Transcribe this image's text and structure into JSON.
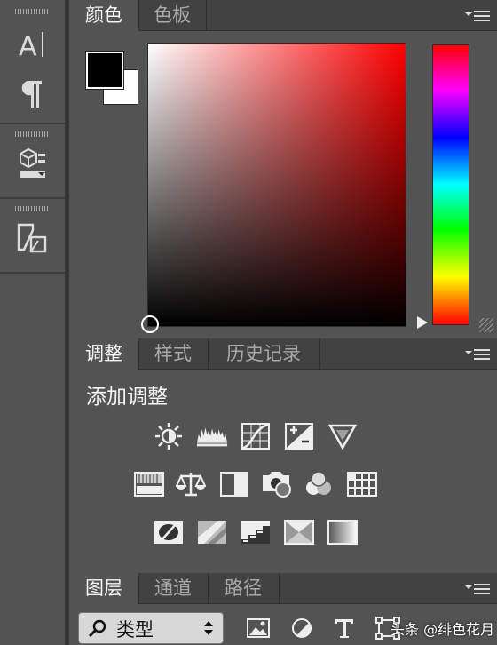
{
  "left_strip": {
    "tools": [
      {
        "icon": "character-icon"
      },
      {
        "icon": "paragraph-icon"
      },
      {
        "icon": "3d-icon"
      },
      {
        "icon": "clone-source-icon"
      }
    ]
  },
  "color_panel": {
    "tabs": [
      {
        "label": "颜色"
      },
      {
        "label": "色板"
      }
    ],
    "foreground_color": "#000000",
    "background_color": "#ffffff",
    "picker_hue": "#ff0000"
  },
  "adjustments_panel": {
    "tabs": [
      {
        "label": "调整"
      },
      {
        "label": "样式"
      },
      {
        "label": "历史记录"
      }
    ],
    "title": "添加调整",
    "rows": [
      [
        "brightness-contrast-icon",
        "levels-icon",
        "curves-icon",
        "exposure-icon",
        "vibrance-icon"
      ],
      [
        "hue-saturation-icon",
        "color-balance-icon",
        "black-white-icon",
        "photo-filter-icon",
        "channel-mixer-icon",
        "color-lookup-icon"
      ],
      [
        "invert-icon",
        "posterize-icon",
        "threshold-icon",
        "selective-color-icon",
        "gradient-map-icon"
      ]
    ]
  },
  "layers_panel": {
    "tabs": [
      {
        "label": "图层"
      },
      {
        "label": "通道"
      },
      {
        "label": "路径"
      }
    ],
    "kind_filter": {
      "label": "类型"
    },
    "filter_icons": [
      "pixel-filter-icon",
      "adjustment-filter-icon",
      "type-filter-icon",
      "shape-filter-icon"
    ]
  },
  "watermark": "头条 @绯色花月"
}
